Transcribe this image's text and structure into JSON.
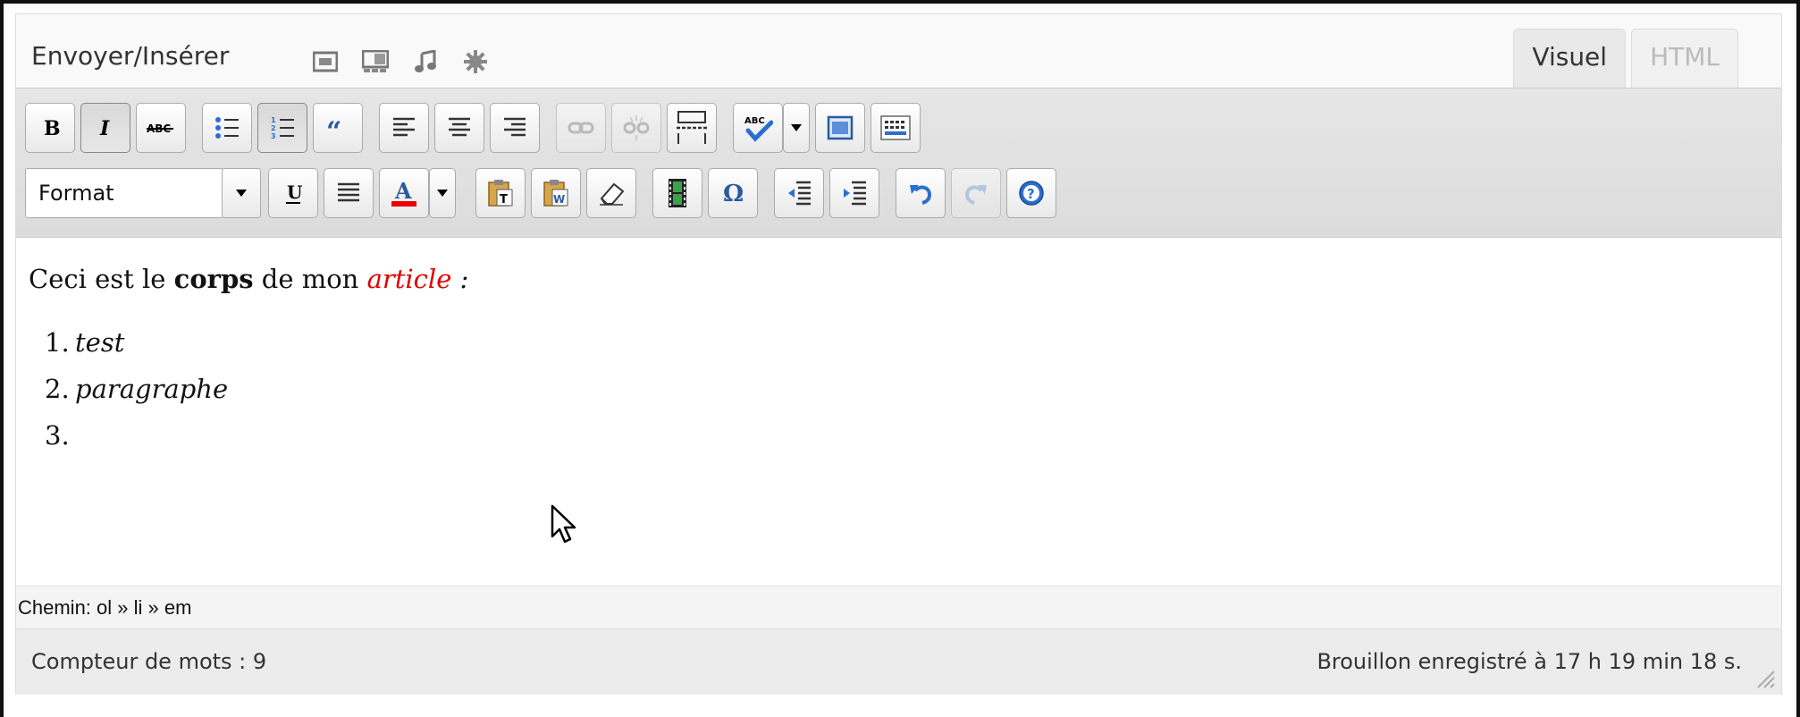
{
  "upload": {
    "label": "Envoyer/Insérer",
    "icons": [
      "image-icon",
      "gallery-icon",
      "audio-icon",
      "media-icon"
    ]
  },
  "tabs": [
    {
      "label": "Visuel",
      "active": true
    },
    {
      "label": "HTML",
      "active": false
    }
  ],
  "toolbar": {
    "row1": [
      "bold-button",
      "italic-button",
      "strikethrough-button",
      "unordered-list-button",
      "ordered-list-button",
      "blockquote-button",
      "align-left-button",
      "align-center-button",
      "align-right-button",
      "link-button",
      "unlink-button",
      "more-tag-button",
      "spellcheck-button",
      "spellcheck-dropdown",
      "fullscreen-button",
      "kitchen-sink-button"
    ],
    "format_select": "Format",
    "row2": [
      "underline-button",
      "justify-button",
      "text-color-button",
      "text-color-dropdown",
      "paste-text-button",
      "paste-word-button",
      "remove-format-button",
      "embed-media-button",
      "special-char-button",
      "outdent-button",
      "indent-button",
      "undo-button",
      "redo-button",
      "help-button"
    ],
    "accent_colors": {
      "text_color_bar": "#ee0000",
      "help_blue": "#2a6fd0"
    }
  },
  "content": {
    "intro_before": "Ceci est le ",
    "intro_bold": "corps",
    "intro_middle": " de mon ",
    "intro_red": "article",
    "intro_after": " :",
    "list": [
      {
        "num": "1.",
        "text": "test"
      },
      {
        "num": "2.",
        "text": "paragraphe"
      },
      {
        "num": "3.",
        "text": ""
      }
    ],
    "red_color": "#e00000"
  },
  "pathbar": {
    "text": "Chemin: ol » li » em"
  },
  "status": {
    "word_count": "Compteur de mots : 9",
    "draft_saved": "Brouillon enregistré à 17 h 19 min 18 s."
  }
}
